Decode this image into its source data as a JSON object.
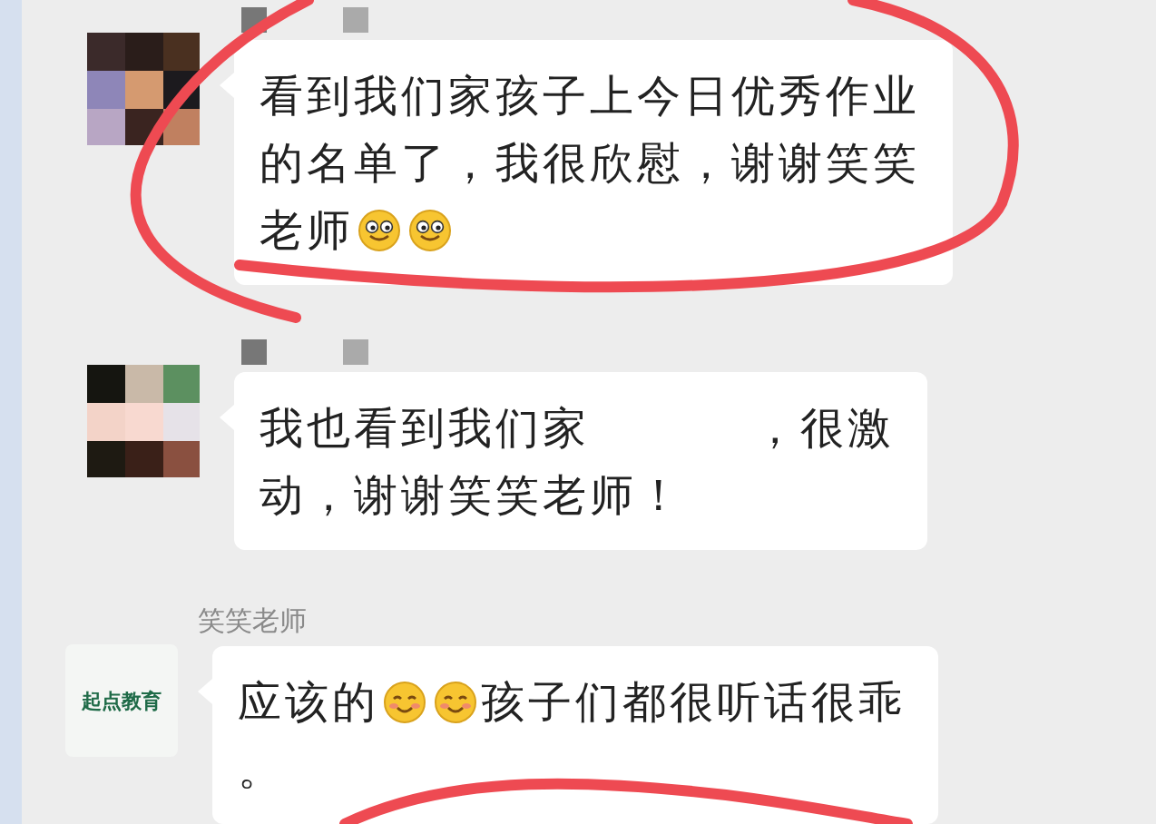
{
  "messages": [
    {
      "kind": "mosaic",
      "lines": [
        [
          {
            "kind": "text",
            "text": "看到我们家孩子上今日优秀作业"
          }
        ],
        [
          {
            "kind": "text",
            "text": "的名单了，我很欣慰，谢谢笑笑"
          }
        ],
        [
          {
            "kind": "text",
            "text": "老师"
          },
          {
            "kind": "smile-emoji"
          },
          {
            "kind": "smile-emoji"
          }
        ]
      ]
    },
    {
      "kind": "mosaic",
      "lines": [
        [
          {
            "kind": "text",
            "text": "我也看到我们家"
          },
          {
            "kind": "gap"
          },
          {
            "kind": "text",
            "text": "，很激"
          }
        ],
        [
          {
            "kind": "text",
            "text": "动，谢谢笑笑老师！"
          }
        ]
      ]
    },
    {
      "kind": "logo",
      "sender": "笑笑老师",
      "avatar_text": "起点教育",
      "lines": [
        [
          {
            "kind": "text",
            "text": "应该的"
          },
          {
            "kind": "blush-emoji"
          },
          {
            "kind": "blush-emoji"
          },
          {
            "kind": "text",
            "text": "孩子们都很听话很乖"
          }
        ],
        [
          {
            "kind": "text",
            "text": "。"
          }
        ]
      ]
    }
  ]
}
